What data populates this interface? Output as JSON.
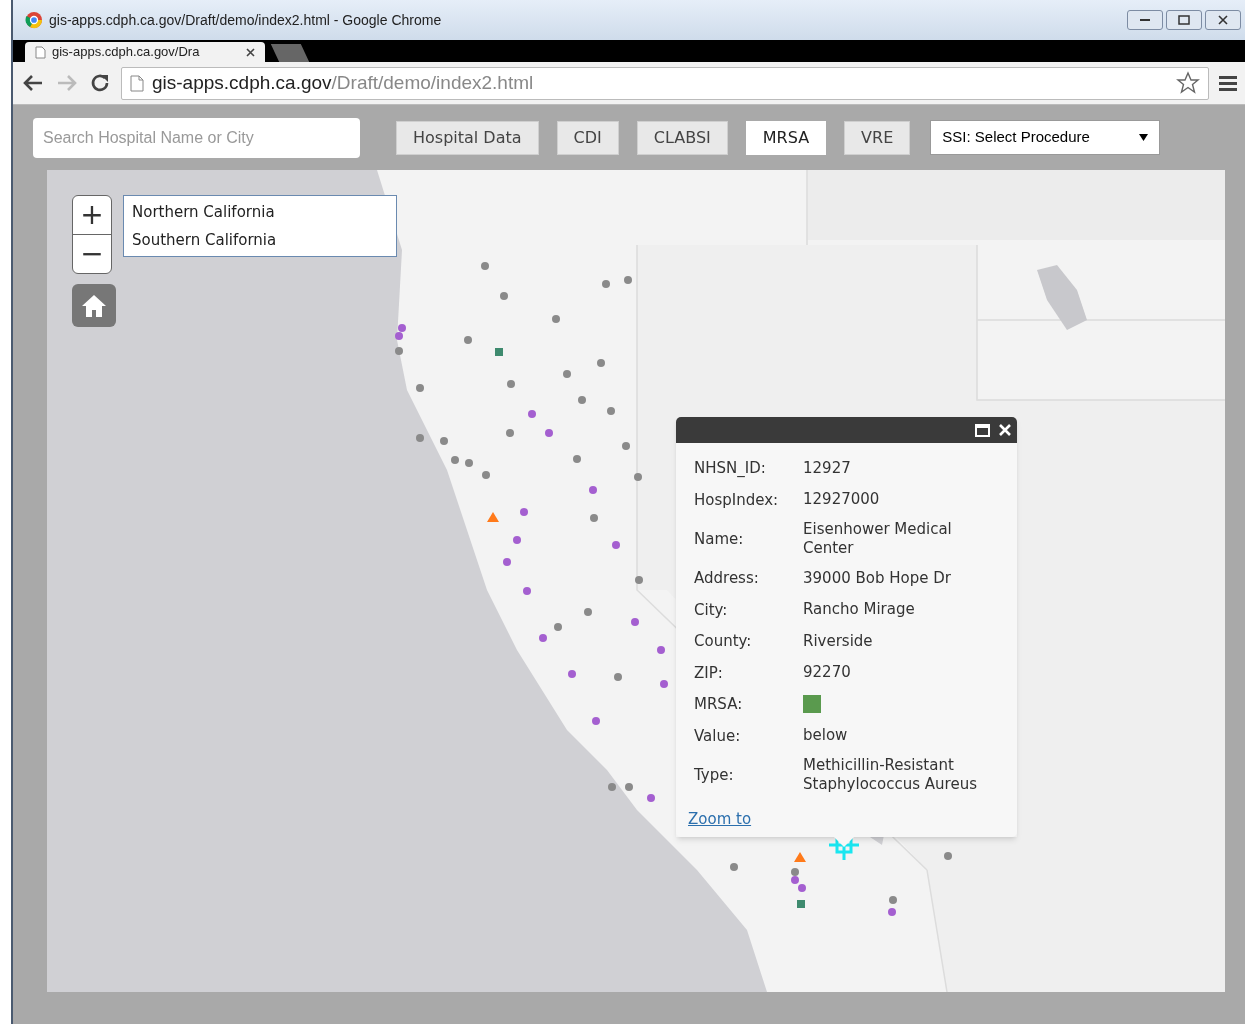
{
  "window": {
    "title": "gis-apps.cdph.ca.gov/Draft/demo/index2.html - Google Chrome"
  },
  "tabs": [
    {
      "label": "gis-apps.cdph.ca.gov/Dra",
      "selected": true
    }
  ],
  "address_bar": {
    "host": "gis-apps.cdph.ca.gov",
    "path": "/Draft/demo/index2.html"
  },
  "search": {
    "placeholder": "Search Hospital Name or City"
  },
  "layer_buttons": [
    {
      "label": "Hospital Data",
      "selected": false
    },
    {
      "label": "CDI",
      "selected": false
    },
    {
      "label": "CLABSI",
      "selected": false
    },
    {
      "label": "MRSA",
      "selected": true
    },
    {
      "label": "VRE",
      "selected": false
    }
  ],
  "procedure_select": {
    "value": "SSI: Select Procedure"
  },
  "map": {
    "zoom_in": "+",
    "zoom_out": "−",
    "regions": [
      "Northern California",
      "Southern California"
    ],
    "popup": {
      "fields": [
        {
          "kind": "text",
          "label": "NHSN_ID:",
          "value": "12927"
        },
        {
          "kind": "text",
          "label": "HospIndex:",
          "value": "12927000"
        },
        {
          "kind": "text",
          "label": "Name:",
          "value": "Eisenhower Medical Center"
        },
        {
          "kind": "text",
          "label": "Address:",
          "value": "39000 Bob Hope Dr"
        },
        {
          "kind": "text",
          "label": "City:",
          "value": "Rancho Mirage"
        },
        {
          "kind": "text",
          "label": "County:",
          "value": "Riverside"
        },
        {
          "kind": "text",
          "label": "ZIP:",
          "value": "92270"
        },
        {
          "kind": "swatch",
          "label": "MRSA:",
          "color": "#5a9a4e"
        },
        {
          "kind": "text",
          "label": "Value:",
          "value": "below"
        },
        {
          "kind": "text",
          "label": "Type:",
          "value": "Methicillin-Resistant Staphylococcus Aureus"
        }
      ],
      "link": "Zoom to"
    }
  }
}
